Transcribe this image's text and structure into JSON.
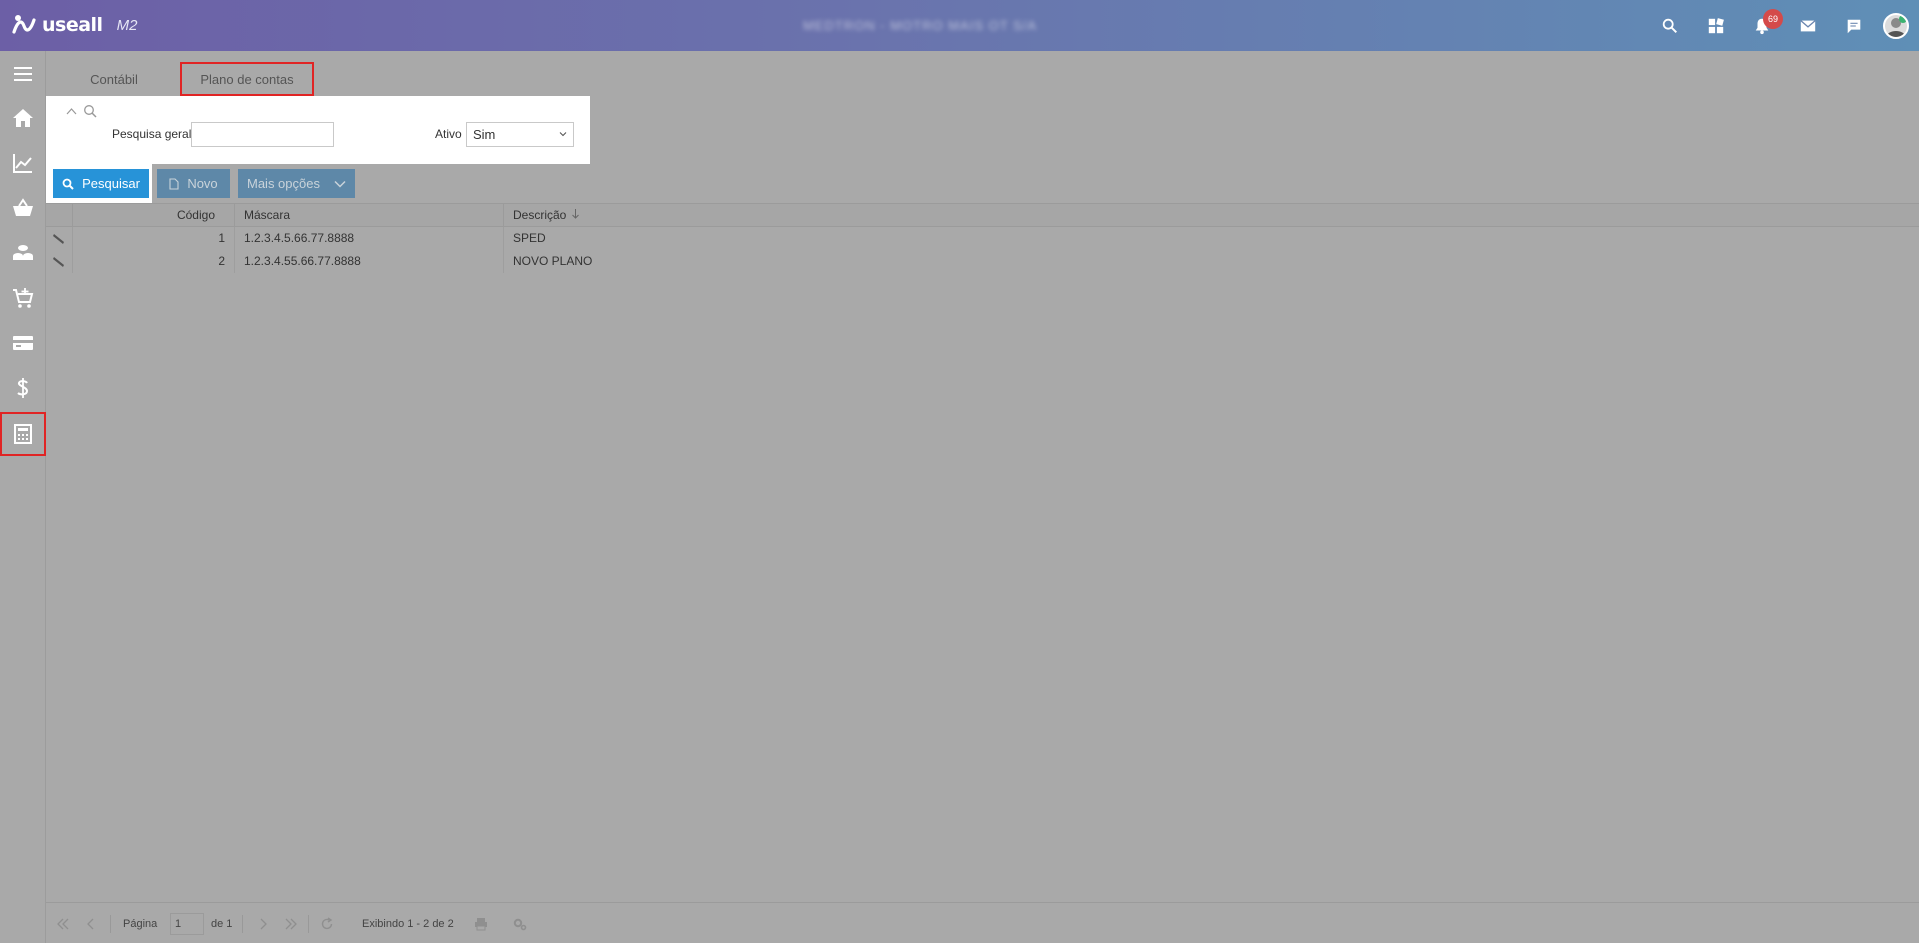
{
  "app": {
    "brand": "useall",
    "version": "M2",
    "company_name": "MEDTRON - MOTRO MAIS OT S/A",
    "notifications_count": "69"
  },
  "sidebar": {
    "items": [
      {
        "name": "menu-icon"
      },
      {
        "name": "home-icon"
      },
      {
        "name": "chart-icon"
      },
      {
        "name": "basket-icon"
      },
      {
        "name": "coins-icon"
      },
      {
        "name": "cart-add-icon"
      },
      {
        "name": "card-icon"
      },
      {
        "name": "dollar-icon"
      },
      {
        "name": "calculator-icon",
        "active": true
      }
    ]
  },
  "tabs": [
    {
      "label": "Contábil"
    },
    {
      "label": "Plano de contas",
      "active": true
    }
  ],
  "filter": {
    "general_search_label": "Pesquisa geral",
    "general_search_value": "",
    "active_label": "Ativo",
    "active_value": "Sim"
  },
  "toolbar": {
    "search_label": "Pesquisar",
    "new_label": "Novo",
    "more_label": "Mais opções"
  },
  "grid": {
    "columns": {
      "code": "Código",
      "mask": "Máscara",
      "description": "Descrição"
    },
    "rows": [
      {
        "code": "1",
        "mask": "1.2.3.4.5.66.77.8888",
        "description": "SPED"
      },
      {
        "code": "2",
        "mask": "1.2.3.4.55.66.77.8888",
        "description": "NOVO PLANO"
      }
    ]
  },
  "pager": {
    "page_label": "Página",
    "page_value": "1",
    "of_label": "de 1",
    "display_text": "Exibindo 1 - 2 de 2"
  }
}
